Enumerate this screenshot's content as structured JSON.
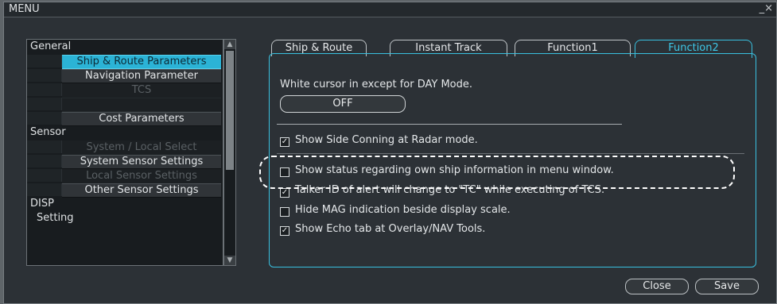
{
  "window": {
    "title": "MENU",
    "controls": "_×"
  },
  "tree": {
    "general": "General",
    "general_items": [
      "Ship & Route Parameters",
      "Navigation Parameter",
      "TCS",
      "",
      "Cost Parameters"
    ],
    "sensor": "Sensor",
    "sensor_items": [
      "System / Local Select",
      "System Sensor Settings",
      "Local Sensor Settings",
      "Other Sensor Settings"
    ],
    "disp": "DISP",
    "setting": "Setting"
  },
  "tabs": [
    "Ship & Route",
    "Instant Track",
    "Function1",
    "Function2"
  ],
  "content": {
    "cursor_label": "White cursor in except for DAY Mode.",
    "cursor_value": "OFF",
    "options": [
      {
        "label": "Show Side Conning at Radar mode.",
        "checked": true
      },
      {
        "label": "Show status regarding own ship information in menu window.",
        "checked": false
      },
      {
        "label": "Talker ID of alert will change to \"TC\" while executing of TCS.",
        "checked": true
      },
      {
        "label": "Hide MAG indication beside display scale.",
        "checked": false
      },
      {
        "label": "Show Echo tab at Overlay/NAV Tools.",
        "checked": true
      }
    ],
    "check_mark": "✓"
  },
  "footer": {
    "close": "Close",
    "save": "Save"
  },
  "colors": {
    "accent": "#39c0df",
    "selected_bg": "#2bb3d6",
    "panel_bg": "#2c3136"
  }
}
